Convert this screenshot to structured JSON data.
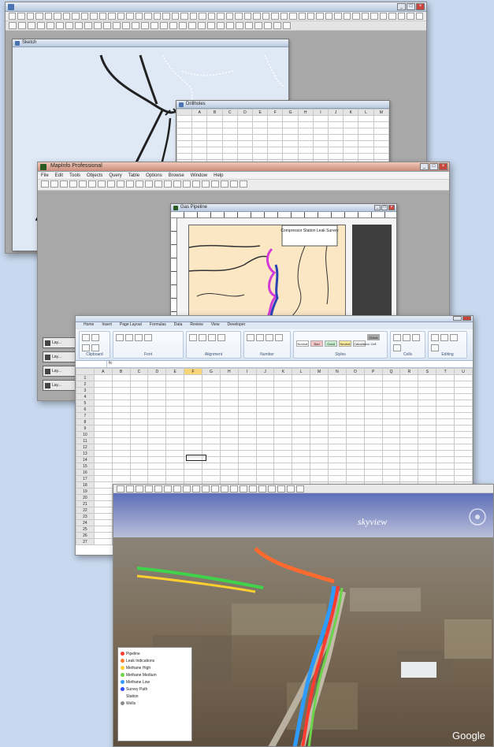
{
  "main_app": {
    "child_table_title": "Drillholes",
    "child_map_title": "Sketch",
    "table_headers": [
      "",
      "A",
      "B",
      "C",
      "D",
      "E",
      "F",
      "G",
      "H",
      "I",
      "J",
      "K",
      "L",
      "M"
    ]
  },
  "mapinfo": {
    "title": "MapInfo Professional",
    "menu": [
      "File",
      "Edit",
      "Tools",
      "Objects",
      "Query",
      "Table",
      "Options",
      "Browse",
      "Window",
      "Help"
    ],
    "child_title": "Gas Pipeline",
    "inset_label": "Compressor Station Leak Survey",
    "minimized_windows": [
      "Lay...",
      "Lay...",
      "Lay...",
      "Lay..."
    ]
  },
  "excel": {
    "tabs": [
      "Home",
      "Insert",
      "Page Layout",
      "Formulas",
      "Data",
      "Review",
      "View",
      "Developer"
    ],
    "groups": [
      "Clipboard",
      "Font",
      "Alignment",
      "Number",
      "Styles",
      "Cells",
      "Editing"
    ],
    "styles": [
      {
        "label": "Normal",
        "color": "#ffffff"
      },
      {
        "label": "Bad",
        "color": "#f5c4c6"
      },
      {
        "label": "Good",
        "color": "#c6eece"
      },
      {
        "label": "Neutral",
        "color": "#fbeb9c"
      },
      {
        "label": "Calculation",
        "color": "#f2f2f2"
      },
      {
        "label": "Check Cell",
        "color": "#a5a5a5"
      }
    ],
    "highlighted_col": "F"
  },
  "google_earth": {
    "watermark": "skyview",
    "logo": "Google",
    "legend_items": [
      {
        "label": "Pipeline",
        "color": "#ff3a2e"
      },
      {
        "label": "Leak Indications",
        "color": "#ff7a2e"
      },
      {
        "label": "Methane High",
        "color": "#ffd02e"
      },
      {
        "label": "Methane Medium",
        "color": "#6bd44a"
      },
      {
        "label": "Methane Low",
        "color": "#2e9cff"
      },
      {
        "label": "Survey Path",
        "color": "#2e4bff"
      },
      {
        "label": "Station",
        "color": "#b02effd"
      },
      {
        "label": "Wells",
        "color": "#888888"
      }
    ]
  },
  "colors": {
    "sky": "#6f87c5",
    "terrain": "#7b6a55",
    "map_background": "#fbe7c4",
    "pipeline_magenta": "#d43ad8",
    "pipeline_blue": "#2a43b5"
  }
}
